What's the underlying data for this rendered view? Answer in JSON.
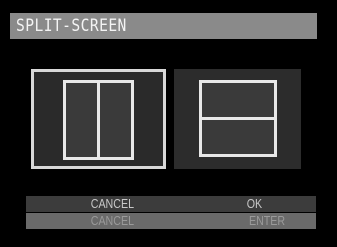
{
  "screen": {
    "title": "SPLIT-SCREEN"
  },
  "options": [
    {
      "name": "Vertical split",
      "selected": true
    },
    {
      "name": "Horizontal split",
      "selected": false
    }
  ],
  "footer": {
    "cancel_label": "CANCEL",
    "cancel_key": "CANCEL",
    "ok_label": "OK",
    "ok_key": "ENTER"
  },
  "colors": {
    "background": "#000000",
    "title_bar": "#8a8a8a",
    "frame_stroke": "#e8e8e8",
    "selected_border": "#d8d8d8"
  }
}
